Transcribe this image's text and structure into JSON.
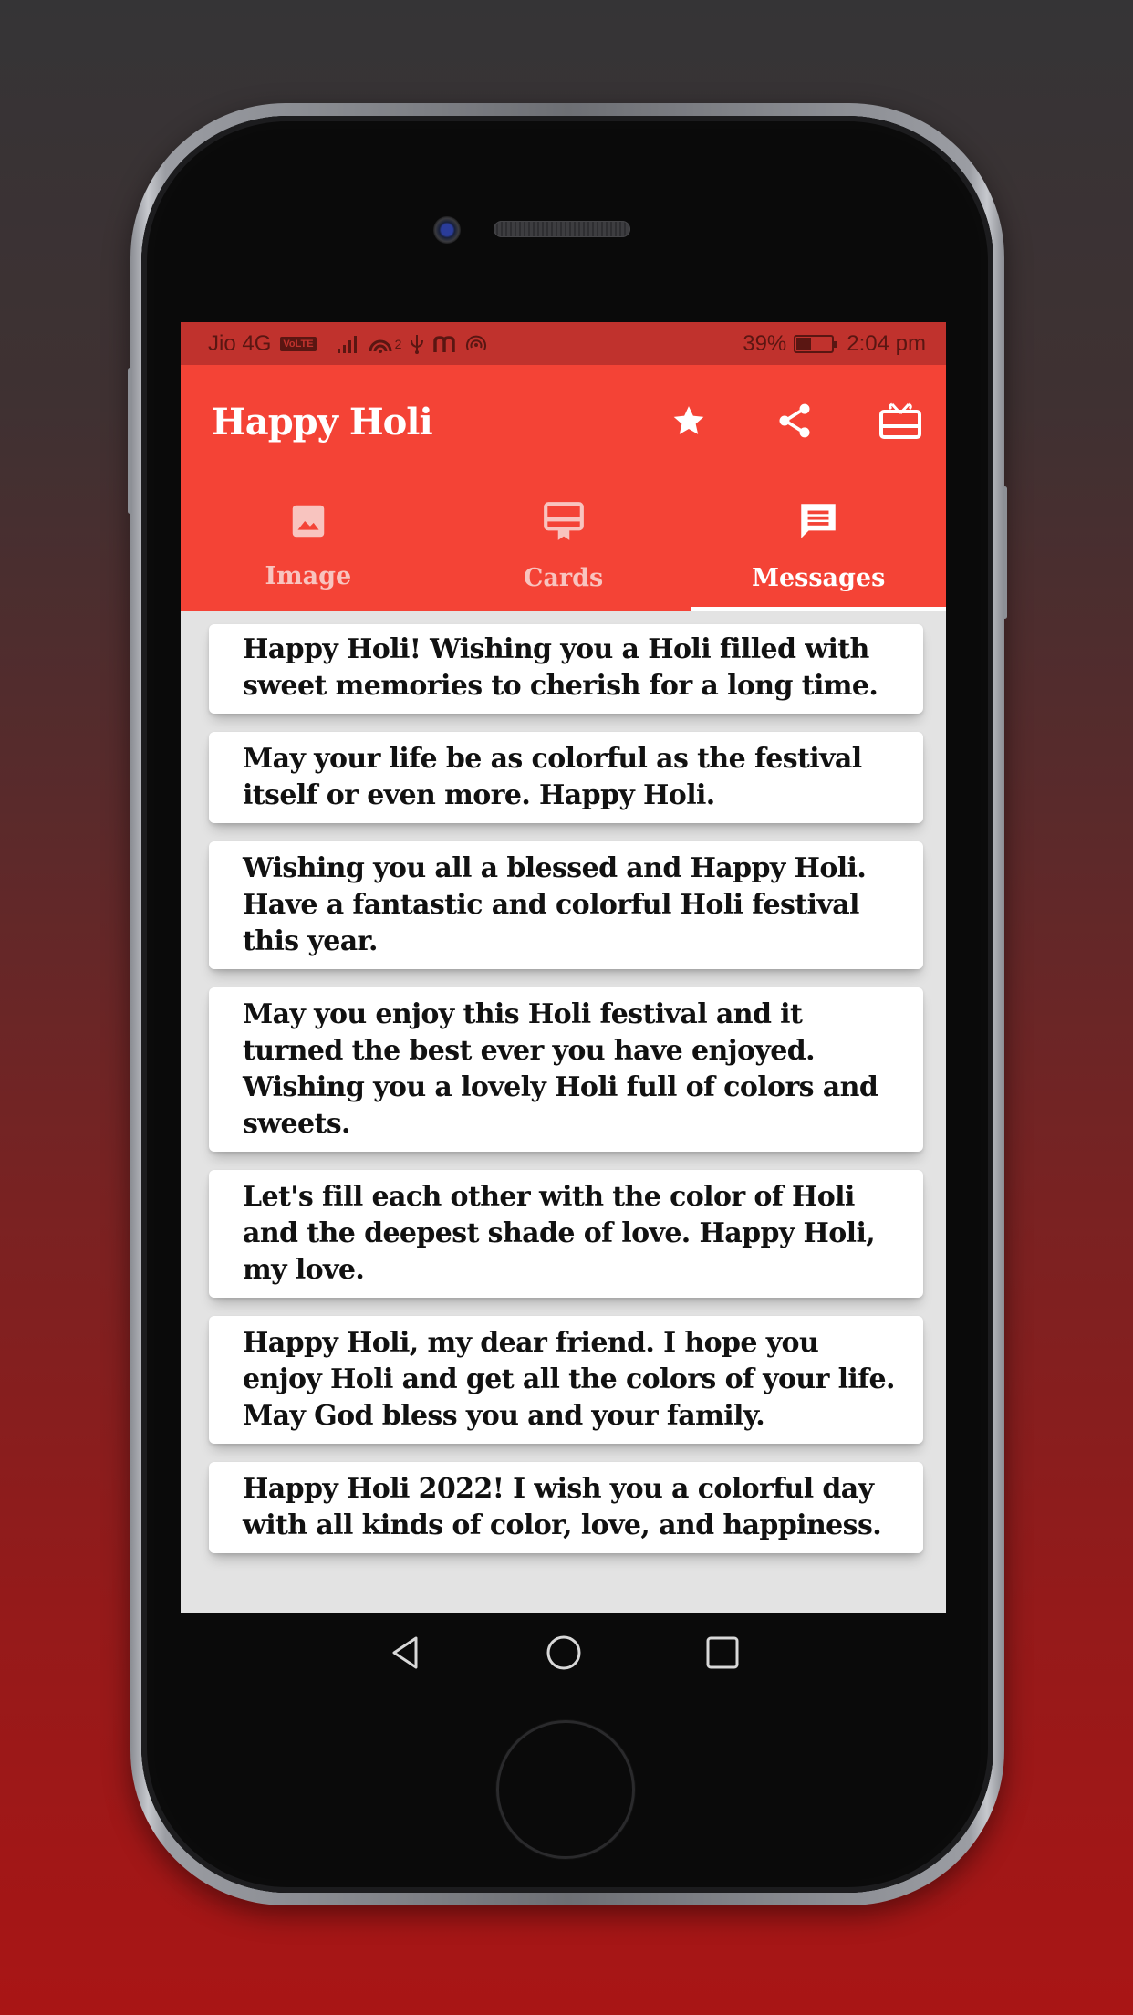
{
  "status_bar": {
    "carrier": "Jio 4G",
    "volte_badge": "VoLTE",
    "icons": [
      "signal-bars-icon",
      "hotspot-icon",
      "usb-icon",
      "m-notification-icon",
      "wireless-icon"
    ],
    "hotspot_superscript": "2",
    "battery_percent": "39%",
    "battery_level": 0.39,
    "time": "2:04 pm"
  },
  "app_bar": {
    "title": "Happy Holi",
    "actions": [
      {
        "name": "rate",
        "icon": "star-icon"
      },
      {
        "name": "share",
        "icon": "share-icon"
      },
      {
        "name": "gift",
        "icon": "gift-card-icon"
      }
    ]
  },
  "tabs": [
    {
      "label": "Image",
      "icon": "image-icon",
      "active": false
    },
    {
      "label": "Cards",
      "icon": "card-icon",
      "active": false
    },
    {
      "label": "Messages",
      "icon": "message-icon",
      "active": true
    }
  ],
  "messages": [
    "Happy Holi! Wishing you a Holi filled with sweet memories to cherish for a long time.",
    "May your life be as colorful as the festival itself or even more. Happy Holi.",
    "Wishing you all a blessed and Happy Holi. Have a fantastic and colorful Holi festival this year.",
    "May you enjoy this Holi festival and it turned the best ever you have enjoyed. Wishing you a lovely Holi full of colors and sweets.",
    "Let's fill each other with the color of Holi and the deepest shade of love. Happy Holi, my love.",
    "Happy Holi, my dear friend. I hope you enjoy Holi and get all the colors of your life. May God bless you and your family.",
    "Happy Holi 2022! I wish you a colorful day with all kinds of color, love, and happiness."
  ],
  "nav_bar": {
    "buttons": [
      "back-icon",
      "home-icon",
      "recents-icon"
    ]
  },
  "colors": {
    "primary": "#f44336",
    "status_bar": "#c0322d",
    "background_top": "#353436",
    "background_bottom": "#a91515"
  }
}
